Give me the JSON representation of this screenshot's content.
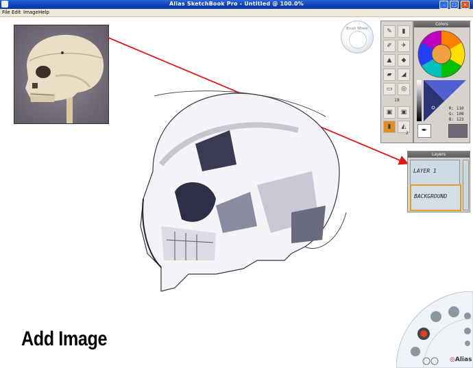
{
  "window": {
    "title": "Alias SketchBook Pro - Untitled @ 100.0%"
  },
  "menu": [
    "File",
    "Edit",
    "Image",
    "Help"
  ],
  "caption": "Add Image",
  "dock": {
    "label": "Brush Wheel"
  },
  "colors_panel": {
    "title": "Colors",
    "r": "R: 110",
    "g": "G: 108",
    "b": "B: 123",
    "current": "#6e6c7b"
  },
  "brushes_panel": {
    "size_label": "18",
    "badge": "2"
  },
  "layers_panel": {
    "title": "Layers",
    "layers": [
      "LAYER 1",
      "BACKGROUND"
    ]
  },
  "brand": "Alias",
  "icons": [
    "close-icon",
    "maximize-icon",
    "minimize-icon",
    "eyedropper-icon",
    "pencil-icon",
    "marker-icon",
    "airbrush-icon",
    "eraser-icon",
    "smudge-icon",
    "color-puck-icon",
    "undo-icon",
    "redo-icon"
  ]
}
